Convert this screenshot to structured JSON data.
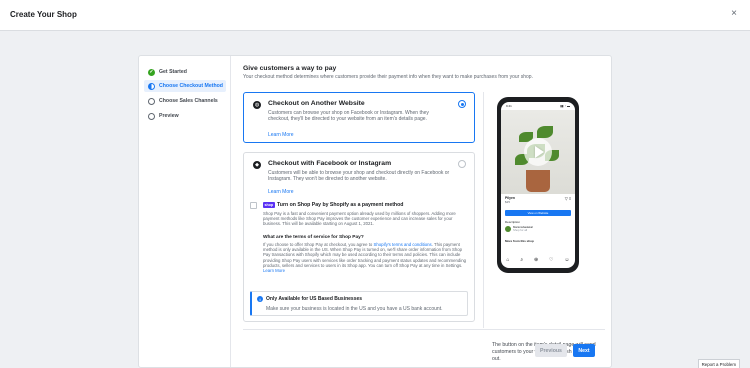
{
  "header": {
    "title": "Create Your Shop",
    "close_icon": "×"
  },
  "steps": [
    {
      "label": "Get Started",
      "state": "done"
    },
    {
      "label": "Choose Checkout Method",
      "state": "current"
    },
    {
      "label": "Choose Sales Channels",
      "state": "todo"
    },
    {
      "label": "Preview",
      "state": "todo"
    }
  ],
  "main": {
    "title": "Give customers a way to pay",
    "subtitle": "Your checkout method determines where customers provide their payment info when they want to make purchases from your shop."
  },
  "option1": {
    "title": "Checkout on Another Website",
    "description": "Customers can browse your shop on Facebook or Instagram. When they checkout, they'll be directed to your website from an item's details page.",
    "learn_more": "Learn More",
    "selected": true
  },
  "option2": {
    "title": "Checkout with Facebook or Instagram",
    "description": "Customers will be able to browse your shop and checkout directly on Facebook or Instagram. They won't be directed to another website.",
    "learn_more": "Learn More",
    "selected": false,
    "shop_pay": {
      "badge": "shop",
      "title": "Turn on Shop Pay by Shopify as a payment method",
      "body": "Shop Pay is a fast and convenient payment option already used by millions of shoppers. Adding more payment methods like Shop Pay improves the customer experience and can increase sales for your business. This will be available starting on August 1, 2021.",
      "terms_heading": "What are the terms of service for Shop Pay?",
      "terms_body_1": "If you choose to offer Shop Pay at checkout, you agree to ",
      "terms_link": "Shopify's terms and conditions",
      "terms_body_2": ". This payment method is only available in the US. When Shop Pay is turned on, we'll share order information from Shop Pay transactions with Shopify which may be used according to their terms and policies. This can include providing Shop Pay users with services like order tracking and payment status updates and recommending products, sellers and services to users in its Shop app. You can turn off Shop Pay at any time in Settings. ",
      "learn_more": "Learn More"
    },
    "notice": {
      "icon": "i",
      "title": "Only Available for US Based Businesses",
      "text": "Make sure your business is located in the US and you have a US bank account."
    }
  },
  "preview": {
    "status_time": "9:41",
    "status_icons": "▮▮ ◔ ▬",
    "product_name": "Pilyen",
    "product_price": "$25",
    "product_sub": "Lorempowell",
    "product_icons": "▽ ⌑",
    "view_button": "View on Website",
    "description_label": "Description",
    "shop_name": "Marionsbadekal",
    "shop_sub": "Shop for all",
    "more_label": "More from this shop",
    "tab_icons": [
      "⌂",
      "⌕",
      "⊕",
      "♡",
      "☺"
    ],
    "caption": "The button on the item's detail page will send customers to your website to finish checking out."
  },
  "footer": {
    "previous": "Previous",
    "next": "Next"
  },
  "report": "Report a Problem",
  "colors": {
    "accent": "#1877f2",
    "success": "#36a420",
    "shop_pay": "#5a31f4"
  }
}
